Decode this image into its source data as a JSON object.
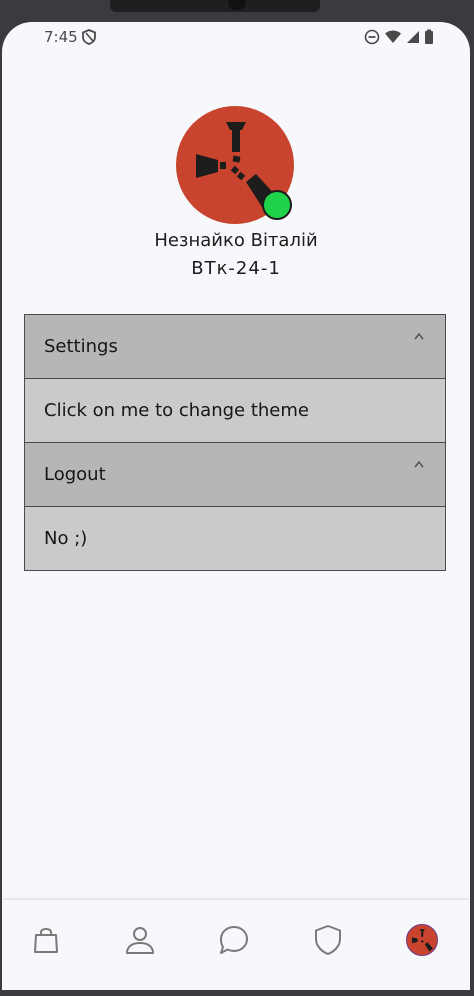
{
  "status_bar": {
    "time": "7:45"
  },
  "profile": {
    "name": "Незнайко Віталій",
    "group": "ВТк-24-1",
    "online": true,
    "status_color": "#1fd24a",
    "avatar_color": "#c8442e"
  },
  "accordion": [
    {
      "title": "Settings",
      "content": "Click on me to change theme"
    },
    {
      "title": "Logout",
      "content": "No ;)"
    }
  ],
  "bottom_nav": {
    "items": [
      "shopping-bag-icon",
      "person-icon",
      "chat-icon",
      "shield-icon",
      "profile-avatar"
    ]
  }
}
